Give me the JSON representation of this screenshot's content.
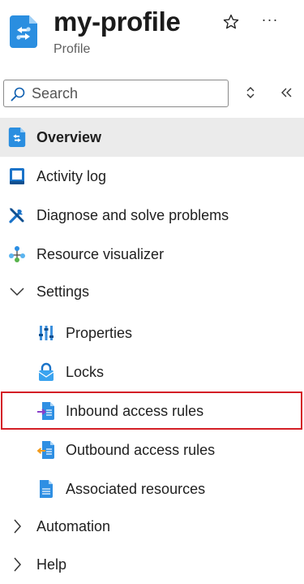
{
  "header": {
    "title": "my-profile",
    "subtitle": "Profile",
    "more_label": "···"
  },
  "search": {
    "placeholder": "Search"
  },
  "nav": {
    "overview": "Overview",
    "activity_log": "Activity log",
    "diagnose": "Diagnose and solve problems",
    "resource_visualizer": "Resource visualizer",
    "settings": "Settings",
    "properties": "Properties",
    "locks": "Locks",
    "inbound": "Inbound access rules",
    "outbound": "Outbound access rules",
    "associated": "Associated resources",
    "automation": "Automation",
    "help": "Help"
  },
  "colors": {
    "accent": "#0078d4",
    "highlight": "#d41f26",
    "selected_bg": "#ebebeb"
  },
  "icons": {
    "resource": "network-profile-icon",
    "star": "star-icon",
    "more": "ellipsis-icon",
    "search": "search-icon",
    "expand_collapse": "chevron-updown-icon",
    "collapse_menu": "double-chevron-left-icon"
  }
}
